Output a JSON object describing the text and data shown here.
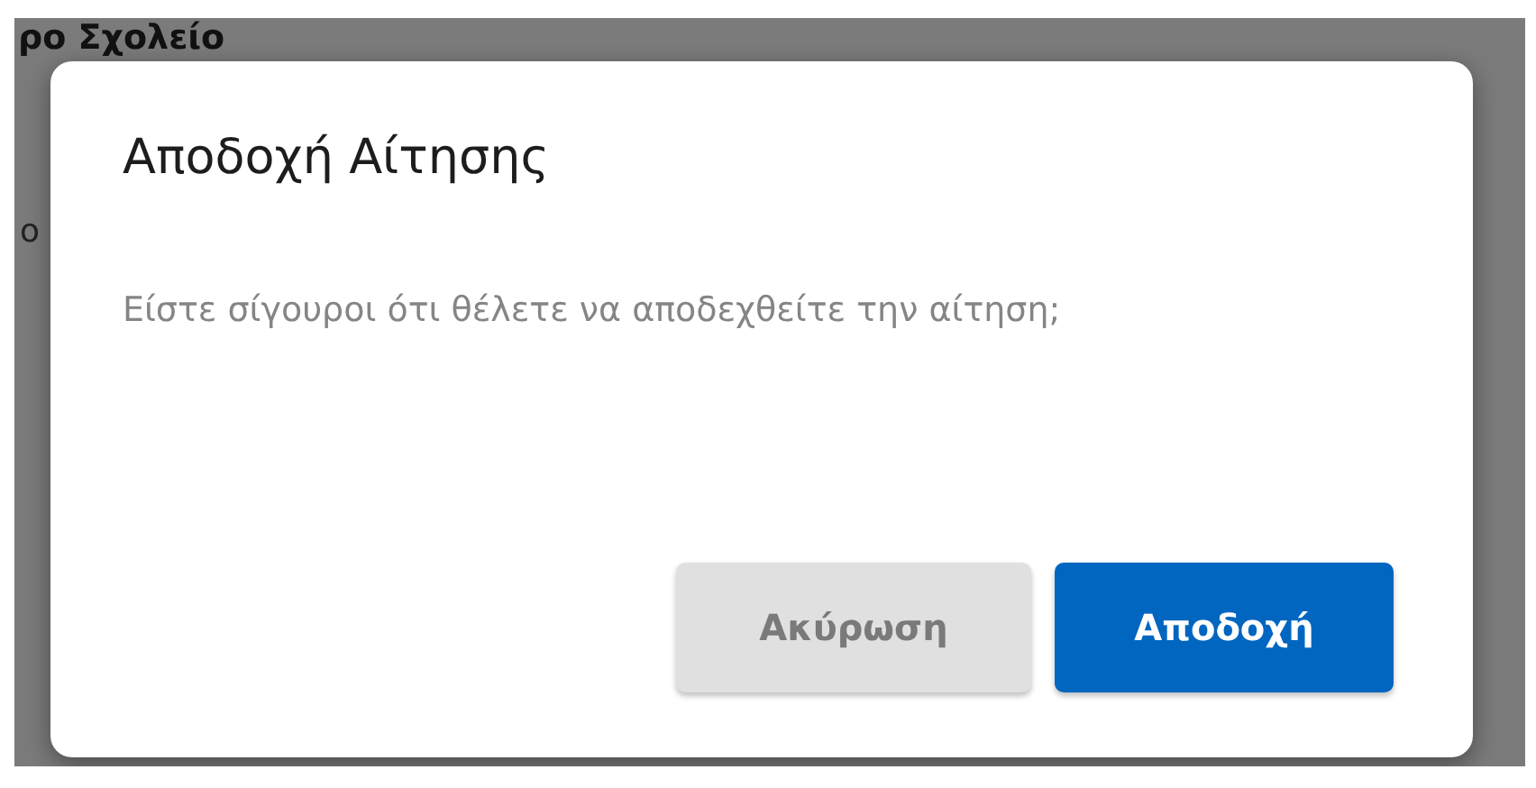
{
  "background": {
    "heading": "ρο Σχολείο",
    "fragment": "ο"
  },
  "dialog": {
    "title": "Αποδοχή Αίτησης",
    "message": "Είστε σίγουροι ότι θέλετε να αποδεχθείτε την αίτηση;",
    "buttons": [
      {
        "label": "Ακύρωση",
        "kind": "secondary",
        "disabled": true
      },
      {
        "label": "Αποδοχή",
        "kind": "primary",
        "disabled": false
      }
    ]
  }
}
